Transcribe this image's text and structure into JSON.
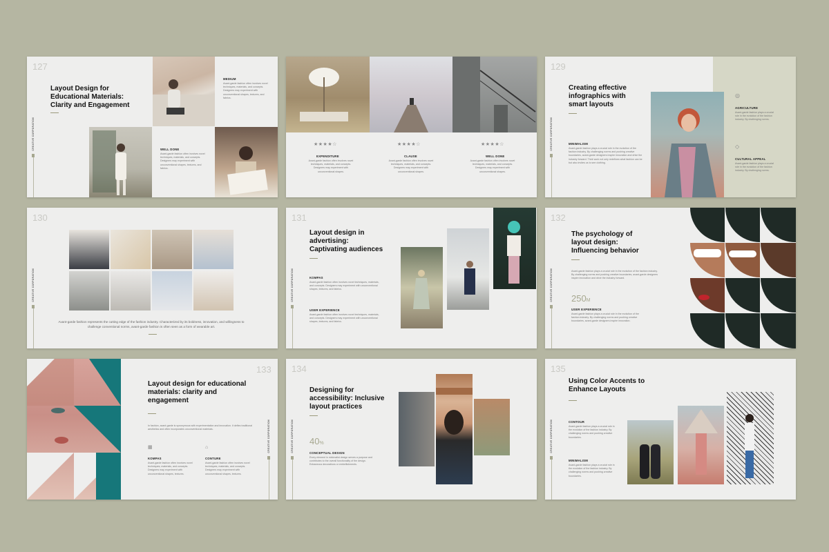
{
  "colors": {
    "background": "#b5b6a2",
    "slide": "#eeeeed",
    "accent": "#9b9a7c",
    "sage_panel": "#d6d7c6",
    "teal": "#16777a"
  },
  "vertical_label": "CREATIVE CORPORATION",
  "s127": {
    "num": "127",
    "title": "Layout Design for Educational Materials: Clarity and Engagement",
    "items": [
      {
        "label": "MEDIUM",
        "text": "Avant-garde fashion often involves novel techniques, materials, and concepts. Designers may experiment with unconventional shapes, textures, and fabrics."
      },
      {
        "label": "WELL DONE",
        "text": "Avant-garde fashion often involves novel techniques, materials, and concepts. Designers may experiment with unconventional shapes, textures, and fabrics."
      }
    ]
  },
  "s128": {
    "columns": [
      {
        "stars": "★★★★☆",
        "label": "EXPENDITURE",
        "text": "Avant-garde fashion often involves novel techniques, materials, and concepts. Designers may experiment with unconventional shapes."
      },
      {
        "stars": "★★★★☆",
        "label": "CLAUSE",
        "text": "Avant-garde fashion often involves novel techniques, materials, and concepts. Designers may experiment with unconventional shapes."
      },
      {
        "stars": "★★★★☆",
        "label": "WELL DONE",
        "text": "Avant-garde fashion often involves novel techniques, materials, and concepts. Designers may experiment with unconventional shapes."
      }
    ]
  },
  "s129": {
    "num": "129",
    "title": "Creating effective infographics with smart layouts",
    "minimalism_label": "MINIMALISM",
    "minimalism_text": "Avant-garde fashion plays a crucial role in the evolution of the fashion industry. By challenging norms and pushing creative boundaries, avant-garde designers inspire innovation and drive the industry forward. Their work not only redefines what fashion can be but also invites us to see clothing.",
    "items": [
      {
        "icon": "◎",
        "label": "AGRICULTURE",
        "text": "Avant-garde fashion plays a crucial role in the evolution of the fashion industry. By challenging norms."
      },
      {
        "icon": "◇",
        "label": "CULTURAL APPEAL",
        "text": "Avant-garde fashion plays a crucial role in the evolution of the fashion industry. By challenging norms."
      }
    ]
  },
  "s130": {
    "num": "130",
    "caption": "Avant-garde fashion represents the cutting edge of the fashion industry. Characterized by its boldness, innovation, and willingness to challenge conventional norms, avant-garde fashion is often seen as a form of wearable art."
  },
  "s131": {
    "num": "131",
    "title": "Layout design in advertising: Captivating audiences",
    "items": [
      {
        "label": "KOMPAS",
        "text": "Avant-garde fashion often involves novel techniques, materials, and concepts. Designers may experiment with unconventional shapes, textures, and fabrics."
      },
      {
        "label": "USER EXPERIENCE",
        "text": "Avant-garde fashion often involves novel techniques, materials, and concepts. Designers may experiment with unconventional shapes, textures, and fabrics."
      }
    ]
  },
  "s132": {
    "num": "132",
    "title": "The psychology of layout design: Influencing behavior",
    "intro": "Avant-garde fashion plays a crucial role in the evolution of the fashion industry. By challenging norms and pushing creative boundaries, avant-garde designers inspire innovation and drive the industry forward.",
    "stat": "250",
    "stat_unit": "M",
    "label": "USER EXPERIENCE",
    "text": "Avant-garde fashion plays a crucial role in the evolution of the fashion industry. By challenging norms and pushing creative boundaries, avant-garde designers inspire innovation."
  },
  "s133": {
    "num": "133",
    "title": "Layout design for educational materials: clarity and engagement",
    "intro": "In fashion, avant-garde is synonymous with experimentation and innovation. It defies traditional aesthetics and often incorporates unconventional materials.",
    "items": [
      {
        "label": "KOMPAS",
        "text": "Avant-garde fashion often involves novel techniques, materials, and concepts. Designers may experiment with unconventional shapes, textures."
      },
      {
        "label": "CONTURE",
        "text": "Avant-garde fashion often involves novel techniques, materials, and concepts. Designers may experiment with unconventional shapes, textures."
      }
    ]
  },
  "s134": {
    "num": "134",
    "title": "Designing for accessibility: Inclusive layout practices",
    "stat": "40",
    "stat_unit": "%",
    "label": "CONCEPTUAL DESIGN",
    "text": "Every element in minimalist design serves a purpose and contributes to the overall functionality of the design. Extraneous decorations or embellishments."
  },
  "s135": {
    "num": "135",
    "title": "Using Color Accents to Enhance Layouts",
    "items": [
      {
        "label": "CONTOUR",
        "text": "Avant-garde fashion plays a crucial role in the evolution of the fashion industry. By challenging norms and pushing creative boundaries."
      },
      {
        "label": "MINIMALISM",
        "text": "Avant-garde fashion plays a crucial role in the evolution of the fashion industry. By challenging norms and pushing creative boundaries."
      }
    ]
  }
}
